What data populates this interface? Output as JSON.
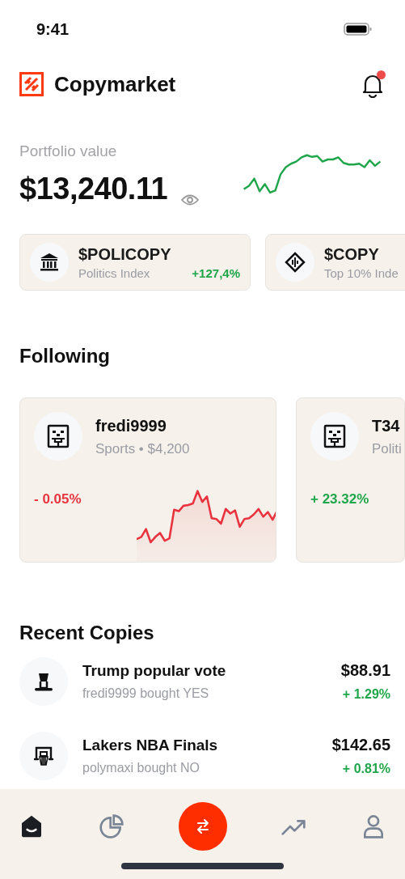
{
  "status_bar": {
    "time": "9:41"
  },
  "header": {
    "title": "Copymarket",
    "notifications_unread": true
  },
  "portfolio": {
    "label": "Portfolio value",
    "value": "$13,240.11"
  },
  "indexes": [
    {
      "name": "$POLICOPY",
      "subtitle": "Politics Index",
      "change": "+127,4%",
      "positive": true
    },
    {
      "name": "$COPY",
      "subtitle": "Top 10% Inde"
    }
  ],
  "following": {
    "title": "Following",
    "traders": [
      {
        "name": "fredi9999",
        "subtitle": "Sports • $4,200",
        "change": "- 0.05%",
        "positive": false
      },
      {
        "name": "T34",
        "subtitle": "Politi",
        "change": "+ 23.32%",
        "positive": true
      }
    ]
  },
  "recent_copies": {
    "title": "Recent Copies",
    "items": [
      {
        "title": "Trump popular vote",
        "subtitle": "fredi9999 bought YES",
        "price": "$88.91",
        "change": "+ 1.29%",
        "positive": true
      },
      {
        "title": "Lakers NBA Finals",
        "subtitle": "polymaxi bought NO",
        "price": "$142.65",
        "change": "+ 0.81%",
        "positive": true
      }
    ]
  },
  "bottom_nav": [
    {
      "selected": true
    },
    {
      "selected": false
    },
    {
      "selected": false,
      "kind": "action"
    },
    {
      "selected": false
    },
    {
      "selected": false
    }
  ]
}
